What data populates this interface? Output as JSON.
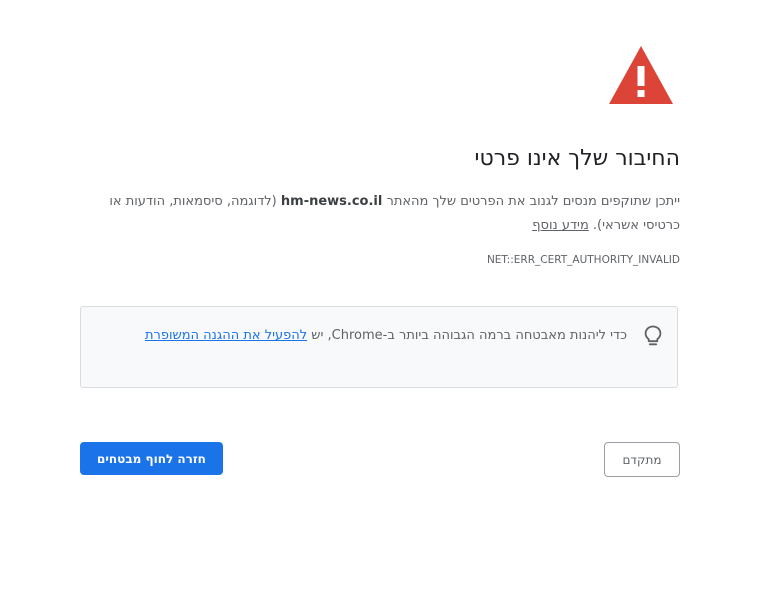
{
  "page": {
    "heading": "החיבור שלך אינו פרטי",
    "description": {
      "before_domain": "ייתכן שתוקפים מנסים לגנוב את הפרטים שלך מהאתר ",
      "domain": "hm-news.co.il",
      "after_domain": " (לדוגמה, סיסמאות, הודעות או כרטיסי אשראי). ",
      "learn_more": "מידע נוסף"
    },
    "error_code": "NET::ERR_CERT_AUTHORITY_INVALID"
  },
  "info_box": {
    "text": "כדי ליהנות מאבטחה ברמה הגבוהה ביותר ב-Chrome, יש ",
    "link": "להפעיל את ההגנה המשופרת"
  },
  "buttons": {
    "back_to_safety": "חזרה לחוף מבטחים",
    "advanced": "מתקדם"
  },
  "colors": {
    "warning_red": "#db4437",
    "primary_blue": "#1a73e8"
  },
  "icons": {
    "warning": "warning-triangle-icon",
    "tip": "lightbulb-icon"
  }
}
